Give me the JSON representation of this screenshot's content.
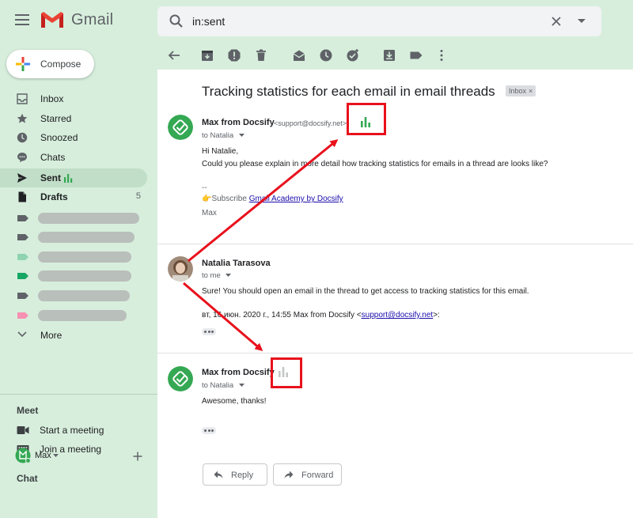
{
  "app": {
    "name": "Gmail"
  },
  "search": {
    "value": "in:sent"
  },
  "compose": {
    "label": "Compose"
  },
  "sidebar": {
    "items": [
      {
        "label": "Inbox",
        "icon": "inbox-icon"
      },
      {
        "label": "Starred",
        "icon": "star-icon"
      },
      {
        "label": "Snoozed",
        "icon": "clock-icon"
      },
      {
        "label": "Chats",
        "icon": "chat-icon"
      },
      {
        "label": "Sent",
        "icon": "send-icon"
      },
      {
        "label": "Drafts",
        "icon": "file-icon",
        "count": "5"
      }
    ],
    "labels": [
      {
        "color": "#5f6368"
      },
      {
        "color": "#5f6368"
      },
      {
        "color": "#8fd3b0"
      },
      {
        "color": "#16a765"
      },
      {
        "color": "#5f6368"
      },
      {
        "color": "#f691b2"
      }
    ],
    "more": "More"
  },
  "meet": {
    "title": "Meet",
    "start": "Start a meeting",
    "join": "Join a meeting"
  },
  "chat": {
    "title": "Chat",
    "user": "Max"
  },
  "thread": {
    "subject": "Tracking statistics for each email in email threads",
    "badge": "Inbox",
    "badge_close": "×",
    "messages": [
      {
        "sender": "Max from Docsify",
        "email": "<support@docsify.net>",
        "to": "to Natalia",
        "greeting": "Hi Natalie,",
        "body": "Could you please explain in more detail how tracking statistics for emails in a thread are looks like?",
        "sig_dash": "--",
        "sig_prefix": "👉Subscribe ",
        "sig_link": "Gmail Academy by Docsify",
        "sig_name": "Max"
      },
      {
        "sender": "Natalia Tarasova",
        "to": "to me",
        "body": "Sure! You should open an email in the thread to get access to tracking statistics for this email.",
        "quote_prefix": "вт, 16 июн. 2020 г., 14:55 Max from Docsify <",
        "quote_link": "support@docsify.net",
        "quote_suffix": ">:"
      },
      {
        "sender": "Max from Docsify",
        "to": "to Natalia",
        "body": "Awesome, thanks!"
      }
    ]
  },
  "actions": {
    "reply": "Reply",
    "forward": "Forward"
  },
  "colors": {
    "accent_green": "#34a853",
    "highlight_red": "#e8111c",
    "sidebar_bg": "#d7eedc"
  }
}
